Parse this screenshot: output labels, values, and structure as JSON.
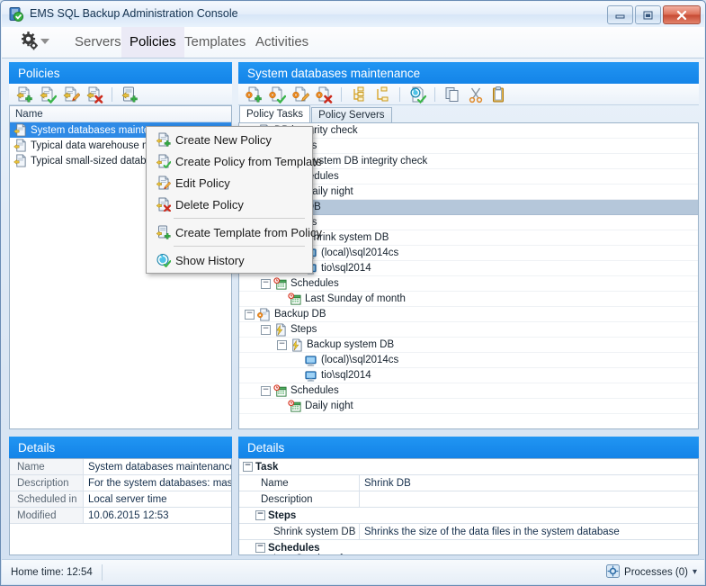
{
  "window": {
    "title": "EMS SQL Backup Administration Console",
    "app_icon": "app-document-check-icon",
    "minimize_label": "–",
    "maximize_label": "▣",
    "close_label": "✕"
  },
  "menubar": {
    "gear_icon": "gear-dropdown-icon",
    "tabs": [
      {
        "label": "Servers",
        "active": false
      },
      {
        "label": "Policies",
        "active": true
      },
      {
        "label": "Templates",
        "active": false
      },
      {
        "label": "Activities",
        "active": false
      }
    ]
  },
  "left_panel": {
    "title": "Policies",
    "toolbar": [
      {
        "name": "create-new-policy-icon",
        "title": "Create New Policy"
      },
      {
        "name": "create-policy-from-template-icon",
        "title": "Create Policy from Template"
      },
      {
        "name": "edit-policy-icon",
        "title": "Edit Policy"
      },
      {
        "name": "delete-policy-icon",
        "title": "Delete Policy"
      },
      {
        "name": "create-template-from-policy-icon",
        "title": "Create Template from Policy"
      }
    ],
    "column_header": "Name",
    "items": [
      {
        "label": "System databases maintenance",
        "selected": true
      },
      {
        "label": "Typical data warehouse mainter",
        "selected": false
      },
      {
        "label": "Typical small-sized database ma",
        "selected": false
      }
    ],
    "details": {
      "title": "Details",
      "rows": [
        {
          "label": "Name",
          "value": "System databases maintenance"
        },
        {
          "label": "Description",
          "value": "For the system databases: master, mode"
        },
        {
          "label": "Scheduled in",
          "value": "Local server time"
        },
        {
          "label": "Modified",
          "value": "10.06.2015 12:53"
        }
      ]
    }
  },
  "right_panel": {
    "title": "System databases maintenance",
    "toolbar": [
      {
        "name": "create-new-task-icon",
        "title": "Create New Task"
      },
      {
        "name": "create-task-from-template-icon",
        "title": "Create Task from Template"
      },
      {
        "name": "edit-task-icon",
        "title": "Edit Task"
      },
      {
        "name": "delete-task-icon",
        "title": "Delete Task"
      },
      {
        "name": "expand-all-icon",
        "title": "Expand All"
      },
      {
        "name": "collapse-all-icon",
        "title": "Collapse All"
      },
      {
        "name": "show-history-icon",
        "title": "Show History"
      },
      {
        "name": "copy-icon",
        "title": "Copy"
      },
      {
        "name": "cut-icon",
        "title": "Cut"
      },
      {
        "name": "paste-icon",
        "title": "Paste"
      }
    ],
    "tabs": [
      {
        "label": "Policy Tasks",
        "active": true
      },
      {
        "label": "Policy Servers",
        "active": false
      }
    ],
    "tree": [
      {
        "label": "DB integrity check",
        "indent": 0,
        "icon": "task-icon",
        "expander": "minus",
        "selected": false
      },
      {
        "label": "Steps",
        "indent": 1,
        "icon": "steps-icon",
        "expander": "minus",
        "selected": false
      },
      {
        "label": "System DB integrity check",
        "indent": 2,
        "icon": "step-icon",
        "expander": "minus",
        "selected": false
      },
      {
        "label": "Schedules",
        "indent": 1,
        "icon": "schedules-icon",
        "expander": "minus",
        "selected": false
      },
      {
        "label": "Daily night",
        "indent": 2,
        "icon": "schedule-icon",
        "expander": "leaf",
        "selected": false
      },
      {
        "label": "Shrink DB",
        "indent": 0,
        "icon": "task-icon",
        "expander": "minus",
        "selected": true
      },
      {
        "label": "Steps",
        "indent": 1,
        "icon": "steps-icon",
        "expander": "minus",
        "selected": false
      },
      {
        "label": "Shrink system DB",
        "indent": 2,
        "icon": "step-icon",
        "expander": "minus",
        "selected": false
      },
      {
        "label": "(local)\\sql2014cs",
        "indent": 3,
        "icon": "server-icon",
        "expander": "leaf",
        "selected": false
      },
      {
        "label": "tio\\sql2014",
        "indent": 3,
        "icon": "server-icon",
        "expander": "leaf",
        "selected": false
      },
      {
        "label": "Schedules",
        "indent": 1,
        "icon": "schedules-icon",
        "expander": "minus",
        "selected": false
      },
      {
        "label": "Last Sunday of month",
        "indent": 2,
        "icon": "schedule-icon",
        "expander": "leaf",
        "selected": false
      },
      {
        "label": "Backup DB",
        "indent": 0,
        "icon": "task-icon",
        "expander": "minus",
        "selected": false
      },
      {
        "label": "Steps",
        "indent": 1,
        "icon": "steps-icon",
        "expander": "minus",
        "selected": false
      },
      {
        "label": "Backup system DB",
        "indent": 2,
        "icon": "step-icon",
        "expander": "minus",
        "selected": false
      },
      {
        "label": "(local)\\sql2014cs",
        "indent": 3,
        "icon": "server-icon",
        "expander": "leaf",
        "selected": false
      },
      {
        "label": "tio\\sql2014",
        "indent": 3,
        "icon": "server-icon",
        "expander": "leaf",
        "selected": false
      },
      {
        "label": "Schedules",
        "indent": 1,
        "icon": "schedules-icon",
        "expander": "minus",
        "selected": false
      },
      {
        "label": "Daily night",
        "indent": 2,
        "icon": "schedule-icon",
        "expander": "leaf",
        "selected": false
      }
    ],
    "details": {
      "title": "Details",
      "rows": [
        {
          "kind": "group",
          "label": "Task",
          "value": "",
          "indent": 0
        },
        {
          "kind": "row",
          "label": "Name",
          "value": "Shrink DB",
          "indent": 1
        },
        {
          "kind": "row",
          "label": "Description",
          "value": "",
          "indent": 1
        },
        {
          "kind": "group",
          "label": "Steps",
          "value": "",
          "indent": 1
        },
        {
          "kind": "row",
          "label": "Shrink system DB",
          "value": "Shrinks the size of the data files in the system database",
          "indent": 2
        },
        {
          "kind": "group",
          "label": "Schedules",
          "value": "",
          "indent": 1
        },
        {
          "kind": "row",
          "label": "Last Sunday of month",
          "value": "",
          "indent": 2
        }
      ]
    }
  },
  "context_menu": [
    {
      "label": "Create New Policy",
      "icon": "create-new-policy-icon",
      "separator_after": false
    },
    {
      "label": "Create Policy from Template",
      "icon": "create-policy-from-template-icon",
      "separator_after": false
    },
    {
      "label": "Edit Policy",
      "icon": "edit-policy-icon",
      "separator_after": false
    },
    {
      "label": "Delete Policy",
      "icon": "delete-policy-icon",
      "separator_after": true
    },
    {
      "label": "Create Template from Policy",
      "icon": "create-template-from-policy-icon",
      "separator_after": true
    },
    {
      "label": "Show History",
      "icon": "show-history-icon",
      "separator_after": false
    }
  ],
  "statusbar": {
    "home_time": "Home time: 12:54",
    "processes": "Processes (0)",
    "processes_icon": "processes-icon",
    "dropdown_arrow": "▾"
  },
  "colors": {
    "panel_header_blue": "#1a8ced",
    "selection_blue": "#2e8ae6",
    "tree_selection": "#b5c7da",
    "close_red": "#c64a33"
  }
}
